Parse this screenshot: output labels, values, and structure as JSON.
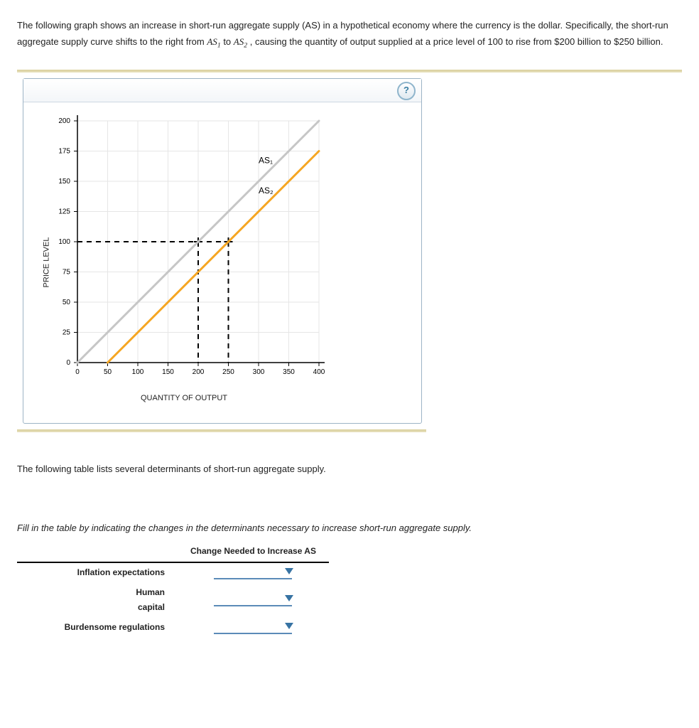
{
  "question": {
    "p1a": "The following graph shows an increase in short-run aggregate supply (AS) in a hypothetical economy where the currency is the dollar. Specifically, the short-run aggregate supply curve shifts to the right from ",
    "as1": "AS",
    "as1sub": "1",
    "p1b": " to ",
    "as2": "AS",
    "as2sub": "2",
    "p1c": ", causing the quantity of output supplied at a price level of 100 to rise from $200 billion to $250 billion."
  },
  "help_label": "?",
  "intro2": "The following table lists several determinants of short-run aggregate supply.",
  "instruction": "Fill in the table by indicating the changes in the determinants necessary to increase short-run aggregate supply.",
  "table": {
    "col2_header": "Change Needed to Increase AS",
    "rows": [
      "Inflation expectations",
      "Human capital",
      "Burdensome regulations"
    ]
  },
  "chart_data": {
    "type": "line",
    "title": "",
    "xlabel": "QUANTITY OF OUTPUT",
    "ylabel": "PRICE LEVEL",
    "xlim": [
      0,
      400
    ],
    "ylim": [
      0,
      200
    ],
    "xticks": [
      0,
      50,
      100,
      150,
      200,
      250,
      300,
      350,
      400
    ],
    "yticks": [
      0,
      25,
      50,
      75,
      100,
      125,
      150,
      175,
      200
    ],
    "series": [
      {
        "name": "AS1",
        "color": "#c6c6c6",
        "x": [
          0,
          400
        ],
        "y": [
          0,
          200
        ]
      },
      {
        "name": "AS2",
        "color": "#f5a623",
        "x": [
          50,
          400
        ],
        "y": [
          0,
          175
        ]
      }
    ],
    "dashed_refs": [
      {
        "x": 200,
        "y": 100
      },
      {
        "x": 250,
        "y": 100
      }
    ],
    "annotations": [
      {
        "text": "AS₁",
        "x": 300,
        "y": 165
      },
      {
        "text": "AS₂",
        "x": 300,
        "y": 140
      }
    ]
  }
}
